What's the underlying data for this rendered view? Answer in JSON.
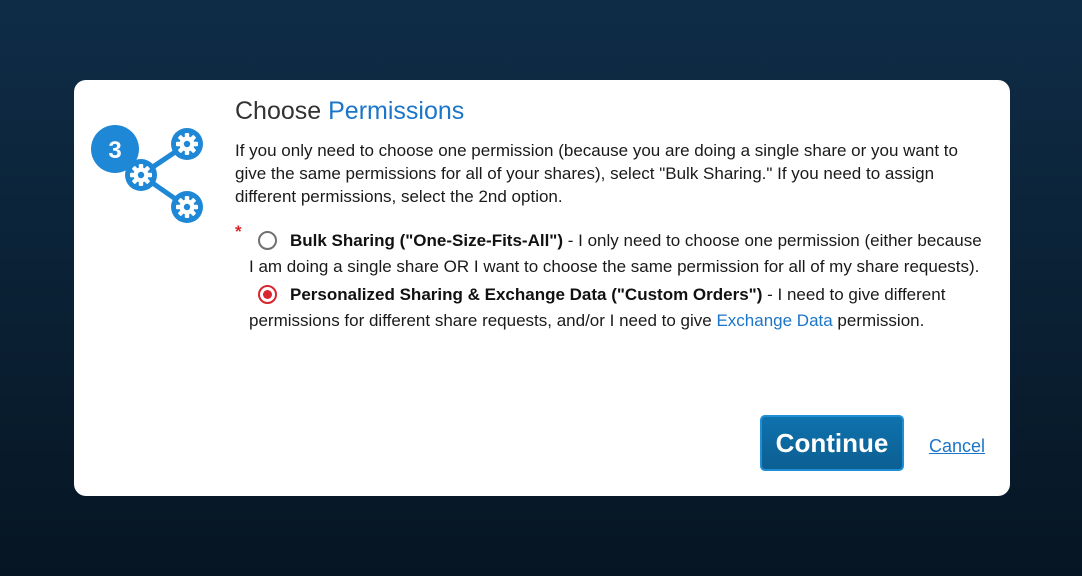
{
  "dialog": {
    "title_prefix": "Choose",
    "title_accent": "Permissions",
    "step_number": "3",
    "intro": "If you only need to choose one permission (because you are doing a single share or you want to give the same permissions for all of your shares), select \"Bulk Sharing.\" If you need to assign different permissions, select the 2nd option.",
    "required_marker": "*",
    "options": [
      {
        "label": "Bulk Sharing (\"One-Size-Fits-All\")",
        "desc": " - I only need to choose one permission (either because I am doing a single share OR I want to choose the same permission for all of my share requests).",
        "selected": false
      },
      {
        "label": "Personalized Sharing & Exchange Data (\"Custom Orders\")",
        "desc_pre": " - I need to give different permissions for different share requests, and/or I need to give ",
        "link": "Exchange Data",
        "desc_post": " permission.",
        "selected": true
      }
    ],
    "continue_label": "Continue",
    "cancel_label": "Cancel"
  },
  "colors": {
    "accent": "#1b75c9",
    "button": "#0f6ea6",
    "radio_selected": "#d9262e",
    "step_icon": "#1e88d6"
  },
  "icons": {
    "step": "share-gears-icon"
  }
}
